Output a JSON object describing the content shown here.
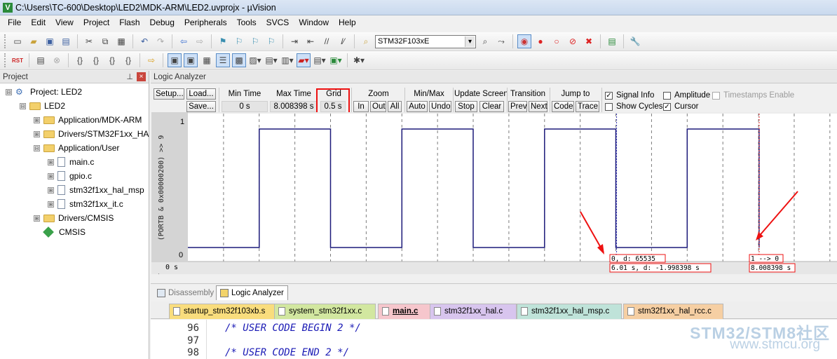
{
  "window": {
    "title": "C:\\Users\\TC-600\\Desktop\\LED2\\MDK-ARM\\LED2.uvprojx - µVision"
  },
  "menu": [
    "File",
    "Edit",
    "View",
    "Project",
    "Flash",
    "Debug",
    "Peripherals",
    "Tools",
    "SVCS",
    "Window",
    "Help"
  ],
  "toolbar": {
    "device": "STM32F103xE",
    "rst_label": "RST"
  },
  "project_panel": {
    "title": "Project",
    "items": [
      {
        "label": "Project: LED2",
        "toggle": "⊟"
      },
      {
        "label": "LED2",
        "toggle": "⊟"
      },
      {
        "label": "Application/MDK-ARM",
        "toggle": "⊞"
      },
      {
        "label": "Drivers/STM32F1xx_HA",
        "toggle": "⊞"
      },
      {
        "label": "Application/User",
        "toggle": "⊟"
      },
      {
        "label": "main.c",
        "toggle": "⊞"
      },
      {
        "label": "gpio.c",
        "toggle": "⊞"
      },
      {
        "label": "stm32f1xx_hal_msp",
        "toggle": "⊞"
      },
      {
        "label": "stm32f1xx_it.c",
        "toggle": "⊞"
      },
      {
        "label": "Drivers/CMSIS",
        "toggle": "⊞"
      },
      {
        "label": "CMSIS",
        "toggle": ""
      }
    ]
  },
  "logic_analyzer": {
    "title": "Logic Analyzer",
    "setup": "Setup...",
    "load": "Load...",
    "save": "Save...",
    "min_time_label": "Min Time",
    "min_time_value": "0 s",
    "max_time_label": "Max Time",
    "max_time_value": "8.008398 s",
    "grid_label": "Grid",
    "grid_value": "0.5 s",
    "zoom_label": "Zoom",
    "zoom_in": "In",
    "zoom_out": "Out",
    "zoom_all": "All",
    "minmax_label": "Min/Max",
    "minmax_auto": "Auto",
    "minmax_undo": "Undo",
    "update_label": "Update Screen",
    "update_stop": "Stop",
    "update_clear": "Clear",
    "transition_label": "Transition",
    "transition_prev": "Prev",
    "transition_next": "Next",
    "jump_label": "Jump to",
    "jump_code": "Code",
    "jump_trace": "Trace",
    "signal_info": "Signal Info",
    "show_cycles": "Show Cycles",
    "amplitude": "Amplitude",
    "cursor": "Cursor",
    "timestamps": "Timestamps Enable",
    "signal_info_checked": true,
    "cursor_checked": true,
    "signal_name": "(PORTB & 0x00000200) >> 9",
    "y_top": "1",
    "y_bottom": "0",
    "time_origin": "0 s",
    "cursor1_info": "0,  d: 65535",
    "cursor1_time": "6.01 s,  d: -1.998398 s",
    "cursor2_info": "1 --> 0",
    "cursor2_time": "8.008398 s"
  },
  "chart_data": {
    "type": "line",
    "signal": "(PORTB & 0x00000200) >> 9",
    "step": true,
    "x_unit": "s",
    "xlim": [
      0,
      9.1
    ],
    "ylim": [
      0,
      1
    ],
    "grid_interval_s": 0.5,
    "series": [
      {
        "x": [
          0,
          1.0,
          1.0,
          2.0,
          2.0,
          3.0,
          3.0,
          4.0,
          4.0,
          5.0,
          5.0,
          6.0,
          6.0,
          7.0,
          7.0,
          8.008398,
          8.008398
        ],
        "y": [
          0,
          0,
          1,
          1,
          0,
          0,
          1,
          1,
          0,
          0,
          1,
          1,
          0,
          0,
          1,
          1,
          0
        ]
      }
    ],
    "cursors_s": [
      6.01,
      8.008398
    ]
  },
  "bottom_tabs": [
    {
      "label": "Disassembly",
      "active": false
    },
    {
      "label": "Logic Analyzer",
      "active": true
    }
  ],
  "file_tabs": [
    {
      "label": "startup_stm32f103xb.s",
      "color": "#f9dd7d"
    },
    {
      "label": "system_stm32f1xx.c",
      "color": "#d2e7a0"
    },
    {
      "label": "main.c",
      "color": "#f6c6cc",
      "active": true
    },
    {
      "label": "stm32f1xx_hal.c",
      "color": "#d8c5ee"
    },
    {
      "label": "stm32f1xx_hal_msp.c",
      "color": "#bfe3d9"
    },
    {
      "label": "stm32f1xx_hal_rcc.c",
      "color": "#f6cfa3"
    }
  ],
  "editor": {
    "lines": [
      {
        "num": "96",
        "code": "/* USER CODE BEGIN 2 */"
      },
      {
        "num": "97",
        "code": ""
      },
      {
        "num": "98",
        "code": "/* USER CODE END 2 */"
      }
    ]
  },
  "watermark": {
    "line1": "STM32/STM8社区",
    "line2": "www.stmcu.org"
  },
  "colors": {
    "signal": "#1c1a7a",
    "annotation": "#e11",
    "grid": "#7c7c7c"
  }
}
